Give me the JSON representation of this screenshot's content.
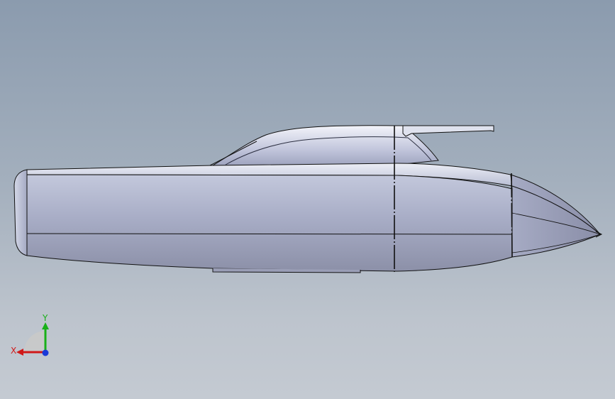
{
  "triad": {
    "x_label": "X",
    "y_label": "Y",
    "x_color": "#d01818",
    "y_color": "#18b018",
    "z_color": "#1a3ad8"
  },
  "model": {
    "hull_color": "#b7bdd6",
    "edge_color": "#111111"
  }
}
